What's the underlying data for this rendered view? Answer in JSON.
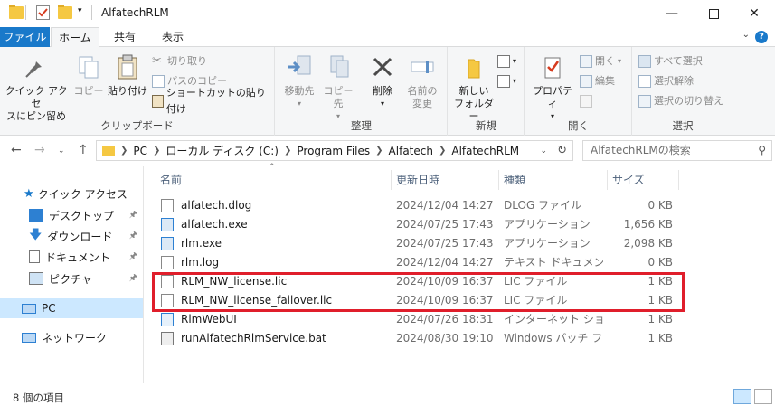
{
  "window": {
    "title": "AlfatechRLM"
  },
  "ribbon_tabs": [
    {
      "label": "ファイル"
    },
    {
      "label": "ホーム"
    },
    {
      "label": "共有"
    },
    {
      "label": "表示"
    }
  ],
  "clipboard": {
    "label": "クリップボード",
    "pin": "クイック アクセ\nスにピン留め",
    "pin_l1": "クイック アクセ",
    "pin_l2": "スにピン留め",
    "copy": "コピー",
    "paste": "貼り付け",
    "cut": "切り取り",
    "copy_path": "パスのコピー",
    "paste_shortcut": "ショートカットの貼り付け"
  },
  "organize": {
    "label": "整理",
    "move_to": "移動先",
    "copy_to": "コピー先",
    "delete": "削除",
    "rename_l1": "名前の",
    "rename_l2": "変更"
  },
  "new": {
    "label": "新規",
    "folder_l1": "新しい",
    "folder_l2": "フォルダー"
  },
  "open": {
    "label": "開く",
    "properties": "プロパティ",
    "open": "開く",
    "edit": "編集"
  },
  "select": {
    "label": "選択",
    "select_all": "すべて選択",
    "select_none": "選択解除",
    "invert": "選択の切り替え"
  },
  "address": {
    "segments": [
      "PC",
      "ローカル ディスク (C:)",
      "Program Files",
      "Alfatech",
      "AlfatechRLM"
    ]
  },
  "search": {
    "placeholder": "AlfatechRLMの検索"
  },
  "nav": {
    "quick_access": "クイック アクセス",
    "desktop": "デスクトップ",
    "downloads": "ダウンロード",
    "documents": "ドキュメント",
    "pictures": "ピクチャ",
    "pc": "PC",
    "network": "ネットワーク"
  },
  "columns": {
    "name": "名前",
    "date": "更新日時",
    "type": "種類",
    "size": "サイズ"
  },
  "files": [
    {
      "name": "alfatech.dlog",
      "date": "2024/12/04 14:27",
      "type": "DLOG ファイル",
      "size": "0 KB"
    },
    {
      "name": "alfatech.exe",
      "date": "2024/07/25 17:43",
      "type": "アプリケーション",
      "size": "1,656 KB"
    },
    {
      "name": "rlm.exe",
      "date": "2024/07/25 17:43",
      "type": "アプリケーション",
      "size": "2,098 KB"
    },
    {
      "name": "rlm.log",
      "date": "2024/12/04 14:27",
      "type": "テキスト ドキュメント",
      "size": "0 KB"
    },
    {
      "name": "RLM_NW_license.lic",
      "date": "2024/10/09 16:37",
      "type": "LIC ファイル",
      "size": "1 KB"
    },
    {
      "name": "RLM_NW_license_failover.lic",
      "date": "2024/10/09 16:37",
      "type": "LIC ファイル",
      "size": "1 KB"
    },
    {
      "name": "RlmWebUI",
      "date": "2024/07/26 18:31",
      "type": "インターネット ショート...",
      "size": "1 KB"
    },
    {
      "name": "runAlfatechRlmService.bat",
      "date": "2024/08/30 19:10",
      "type": "Windows バッチ ファ...",
      "size": "1 KB"
    }
  ],
  "status": {
    "item_count": "8 個の項目"
  },
  "colors": {
    "accent": "#1979ca",
    "highlight_box": "#e01e2b",
    "selected_nav": "#cce8ff"
  }
}
